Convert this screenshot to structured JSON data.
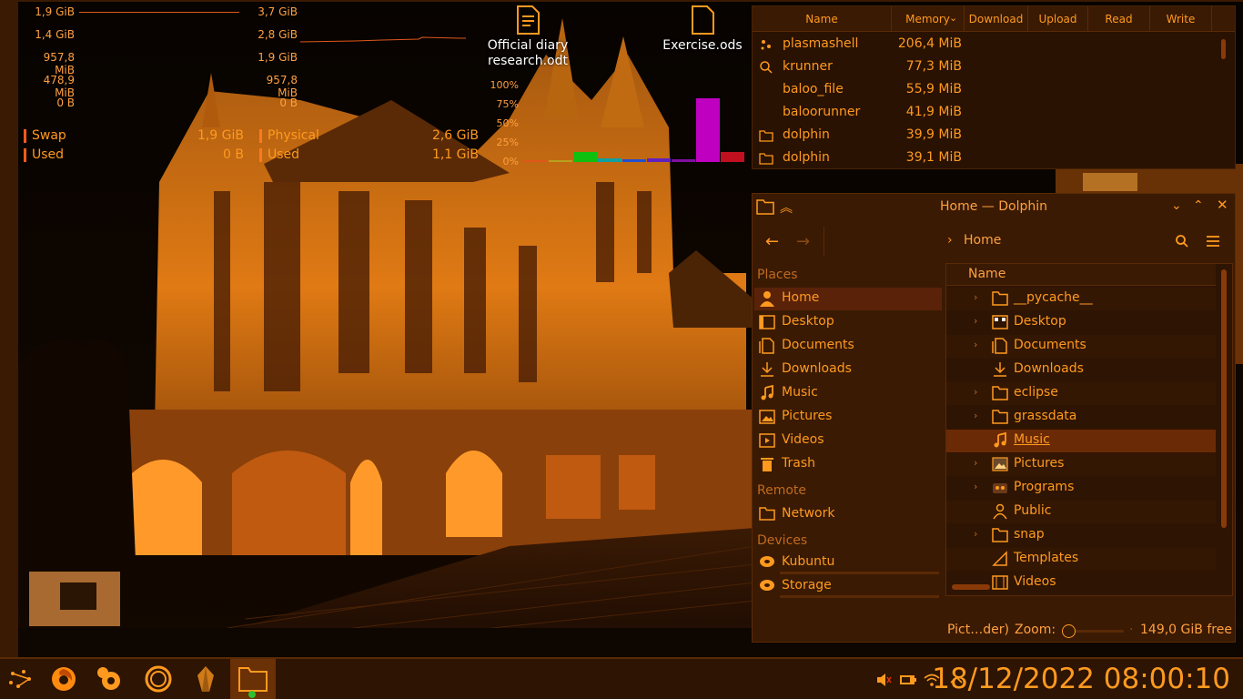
{
  "memory_monitor": {
    "swap_ticks": [
      "1,9 GiB",
      "1,4 GiB",
      "957,8 MiB",
      "478,9 MiB",
      "0 B"
    ],
    "phys_ticks": [
      "3,7 GiB",
      "2,8 GiB",
      "1,9 GiB",
      "957,8 MiB",
      "0 B"
    ],
    "swap": {
      "label": "Swap",
      "value": "1,9 GiB"
    },
    "swap_used": {
      "label": "Used",
      "value": "0 B"
    },
    "physical": {
      "label": "Physical",
      "value": "2,6 GiB"
    },
    "physical_used": {
      "label": "Used",
      "value": "1,1 GiB"
    }
  },
  "cpu_monitor": {
    "ticks": [
      "100%",
      "75%",
      "50%",
      "25%",
      "0%"
    ],
    "bar_levels": [
      0.01,
      0.02,
      0.13,
      0.05,
      0.03,
      0.05,
      0.04,
      0.83,
      0.13
    ],
    "bar_colors": [
      "#e0571a",
      "#b8a020",
      "#10c010",
      "#10a0a0",
      "#2050d0",
      "#6020c0",
      "#8010a0",
      "#c000c0",
      "#c01020"
    ]
  },
  "desktop_icons": [
    {
      "label_line1": "Official diary",
      "label_line2": "research.odt"
    },
    {
      "label_line1": "Exercise.ods",
      "label_line2": ""
    }
  ],
  "process_table": {
    "columns": [
      "Name",
      "Memory",
      "Download",
      "Upload",
      "Read",
      "Write"
    ],
    "rows": [
      {
        "name": "plasmashell",
        "memory": "206,4 MiB",
        "icon": "plasma-icon"
      },
      {
        "name": "krunner",
        "memory": "77,3 MiB",
        "icon": "search-icon"
      },
      {
        "name": "baloo_file",
        "memory": "55,9 MiB",
        "icon": ""
      },
      {
        "name": "baloorunner",
        "memory": "41,9 MiB",
        "icon": ""
      },
      {
        "name": "dolphin",
        "memory": "39,9 MiB",
        "icon": "folder-icon"
      },
      {
        "name": "dolphin",
        "memory": "39,1 MiB",
        "icon": "folder-icon"
      }
    ]
  },
  "dolphin": {
    "title": "Home — Dolphin",
    "breadcrumb": "Home",
    "places_header": "Places",
    "places": [
      "Home",
      "Desktop",
      "Documents",
      "Downloads",
      "Music",
      "Pictures",
      "Videos",
      "Trash"
    ],
    "remote_header": "Remote",
    "remote": [
      "Network"
    ],
    "devices_header": "Devices",
    "devices": [
      "Kubuntu",
      "Storage"
    ],
    "column_name": "Name",
    "files": [
      "__pycache__",
      "Desktop",
      "Documents",
      "Downloads",
      "eclipse",
      "grassdata",
      "Music",
      "Pictures",
      "Programs",
      "Public",
      "snap",
      "Templates",
      "Videos"
    ],
    "status_text": "Pict…der)",
    "zoom_label": "Zoom:",
    "free_space": "149,0 GiB free"
  },
  "panel": {
    "clock": "18/12/2022 08:00:10"
  },
  "colors": {
    "accent": "#ff9a1f",
    "panel_bg": "#2e1402",
    "selection": "#6b2a06"
  }
}
